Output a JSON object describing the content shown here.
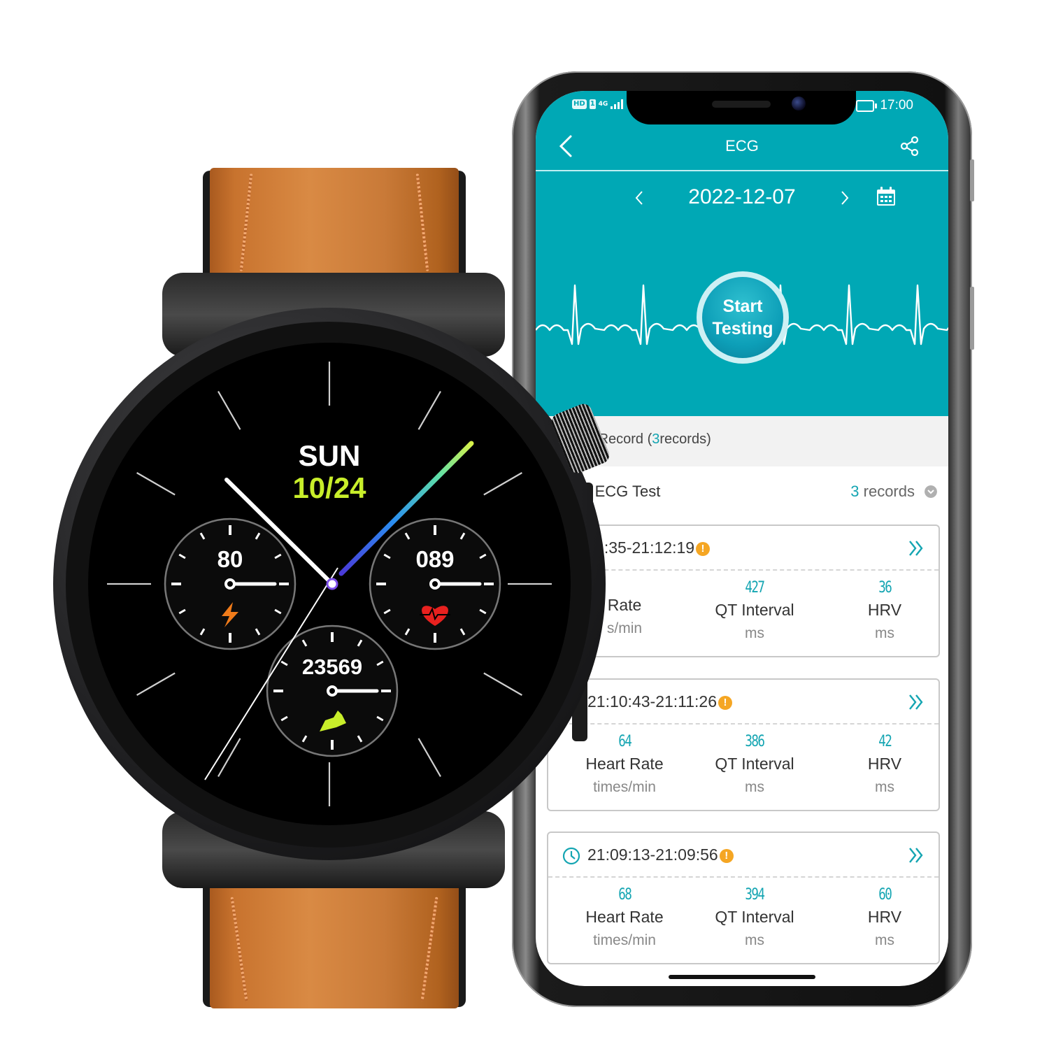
{
  "phone": {
    "status_bar": {
      "hd_badge": "HD",
      "sim_badge": "1",
      "network": "4G",
      "time": "17:00",
      "battery_icon": "battery-icon"
    },
    "nav": {
      "back_icon": "chevron-left-icon",
      "title": "ECG",
      "share_icon": "share-icon"
    },
    "date_nav": {
      "prev_icon": "chevron-left-icon",
      "date": "2022-12-07",
      "next_icon": "chevron-right-icon",
      "calendar_icon": "calendar-icon"
    },
    "start_button": {
      "line1": "Start",
      "line2": "Testing"
    },
    "history": {
      "prefix": "ical Record (",
      "count": "3",
      "suffix": "records)"
    },
    "section": {
      "title": "pp ECG Test",
      "count": "3",
      "count_label": " records",
      "expand_icon": "chevron-down-circle-icon"
    },
    "records": [
      {
        "time_range": "11:35-21:12:19",
        "warning": "!",
        "metrics": [
          {
            "value": "",
            "label": "Rate",
            "unit": "s/min"
          },
          {
            "value": "427",
            "label": "QT Interval",
            "unit": "ms"
          },
          {
            "value": "36",
            "label": "HRV",
            "unit": "ms"
          }
        ]
      },
      {
        "time_range": "21:10:43-21:11:26",
        "warning": "!",
        "metrics": [
          {
            "value": "64",
            "label": "Heart Rate",
            "unit": "times/min"
          },
          {
            "value": "386",
            "label": "QT Interval",
            "unit": "ms"
          },
          {
            "value": "42",
            "label": "HRV",
            "unit": "ms"
          }
        ]
      },
      {
        "time_range": "21:09:13-21:09:56",
        "warning": "!",
        "metrics": [
          {
            "value": "68",
            "label": "Heart Rate",
            "unit": "times/min"
          },
          {
            "value": "394",
            "label": "QT Interval",
            "unit": "ms"
          },
          {
            "value": "60",
            "label": "HRV",
            "unit": "ms"
          }
        ]
      }
    ],
    "colors": {
      "teal": "#00a8b5",
      "accent": "#14a5b2",
      "warning": "#f5a623"
    }
  },
  "watch": {
    "day": "SUN",
    "date": "10/24",
    "subdials": [
      {
        "name": "battery",
        "value": "80",
        "icon": "lightning-icon",
        "icon_color": "#f07b1a"
      },
      {
        "name": "heart-rate",
        "value": "089",
        "icon": "heart-pulse-icon",
        "icon_color": "#e8211f"
      },
      {
        "name": "steps",
        "value": "23569",
        "icon": "shoe-icon",
        "icon_color": "#c8ee2a"
      }
    ],
    "colors": {
      "date": "#c8ee2a",
      "strap": "#c8732e"
    }
  }
}
